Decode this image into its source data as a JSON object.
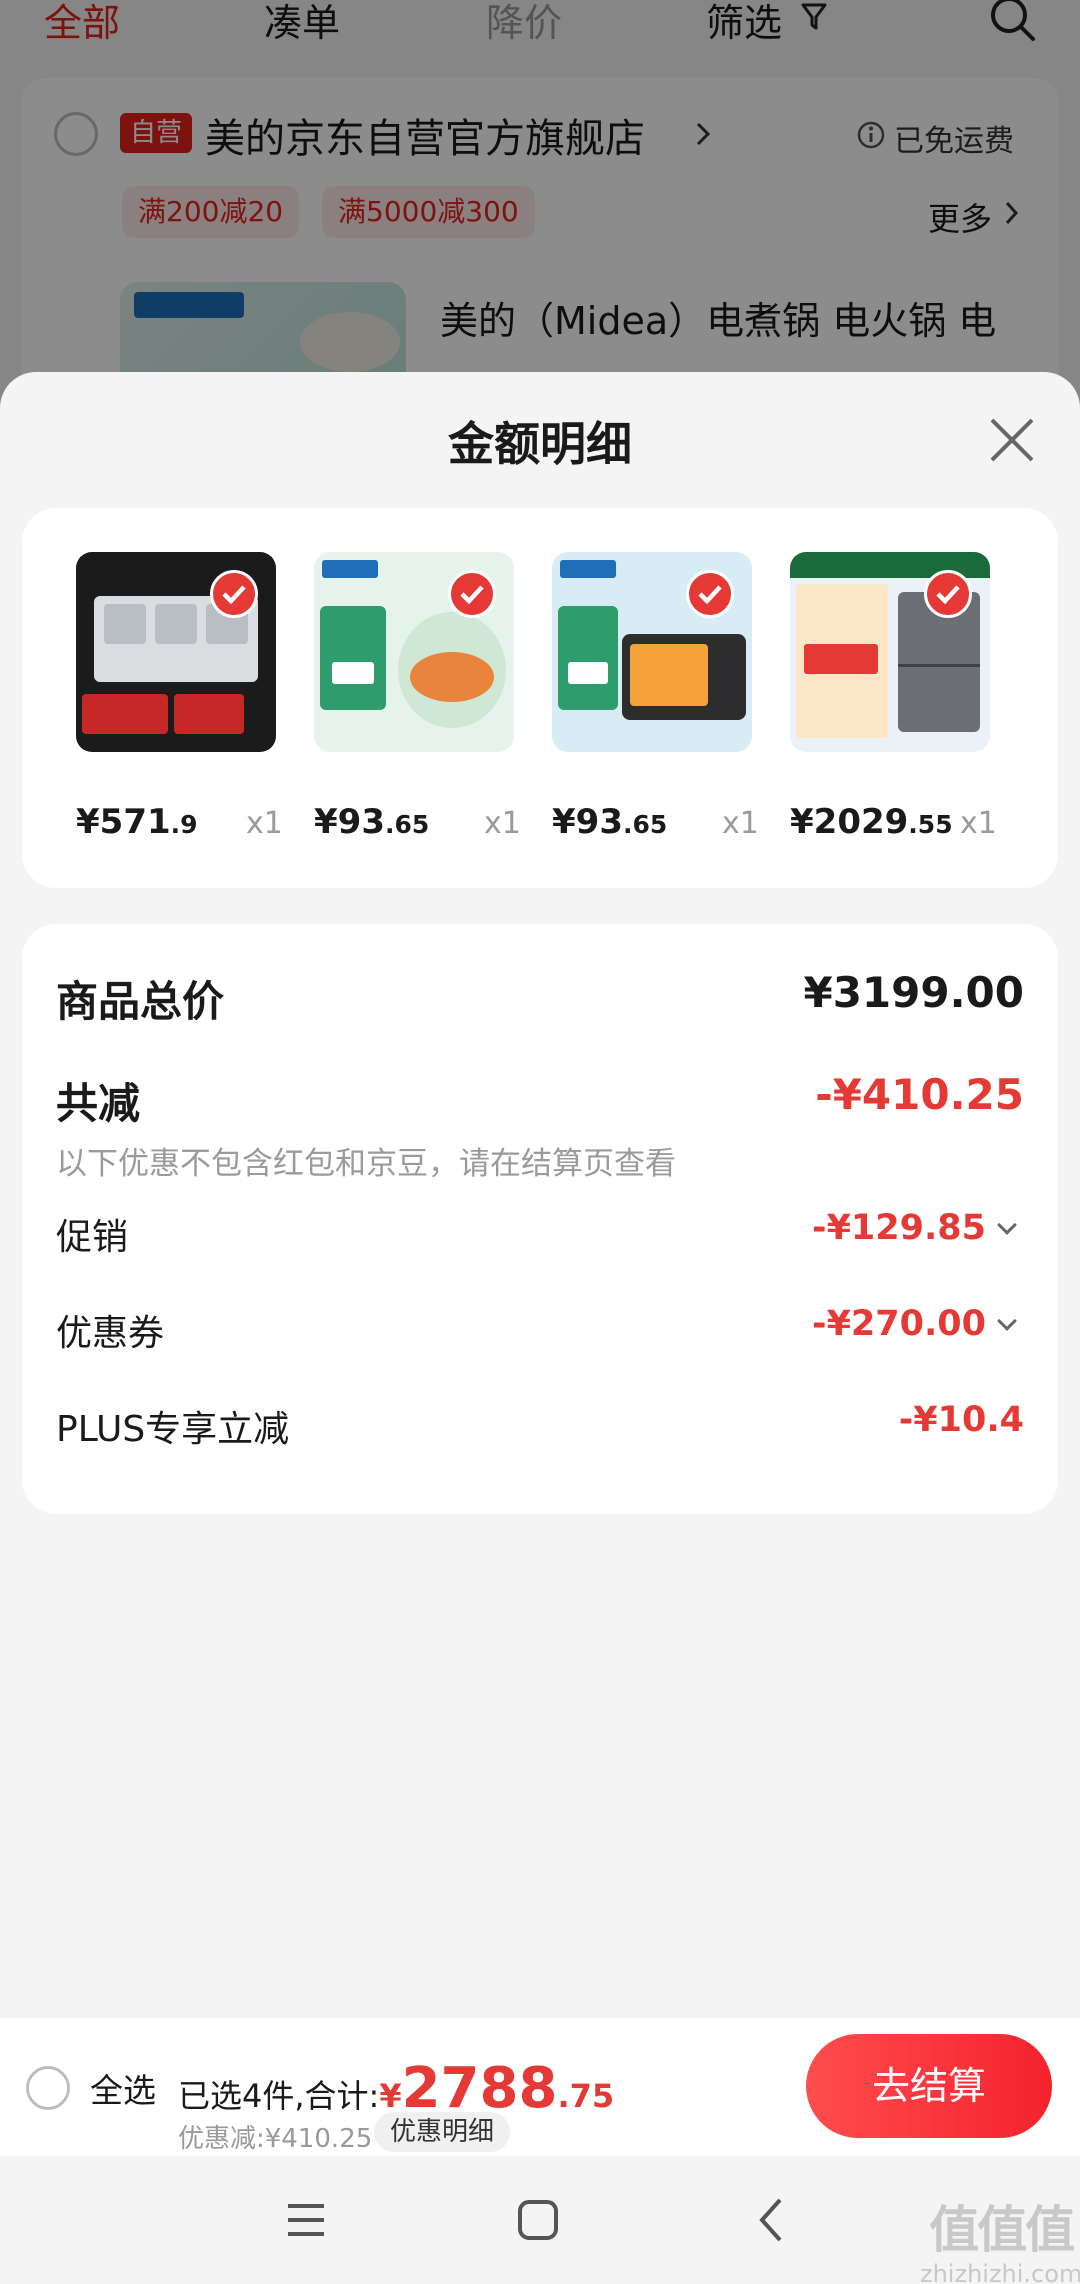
{
  "topnav": {
    "tabs": [
      {
        "label": "全部",
        "color": "#e2231a"
      },
      {
        "label": "凑单",
        "color": "#222222"
      },
      {
        "label": "降价",
        "color": "#9a9a9a"
      },
      {
        "label": "筛选",
        "color": "#222222"
      }
    ],
    "filter_icon": "filter-icon",
    "search_icon": "search-icon"
  },
  "store": {
    "badge": "自营",
    "name": "美的京东自营官方旗舰店",
    "shipping": "已免运费",
    "promos": [
      "满200减20",
      "满5000减300"
    ],
    "more": "更多",
    "first_item_title": "美的（Midea）电煮锅 电火锅 电"
  },
  "sheet": {
    "title": "金额明细",
    "products": [
      {
        "price_int": "¥571",
        "price_dec": ".9",
        "qty": "x1",
        "checked": true
      },
      {
        "price_int": "¥93",
        "price_dec": ".65",
        "qty": "x1",
        "checked": true
      },
      {
        "price_int": "¥93",
        "price_dec": ".65",
        "qty": "x1",
        "checked": true
      },
      {
        "price_int": "¥2029",
        "price_dec": ".55",
        "qty": "x1",
        "checked": true
      }
    ],
    "summary": {
      "total_label": "商品总价",
      "total_value": "¥3199.00",
      "reduce_label": "共减",
      "reduce_value": "-¥410.25",
      "note": "以下优惠不包含红包和京豆，请在结算页查看",
      "items": [
        {
          "label": "促销",
          "value": "-¥129.85"
        },
        {
          "label": "优惠券",
          "value": "-¥270.00"
        },
        {
          "label": "PLUS专享立减",
          "value": "-¥10.4"
        }
      ]
    }
  },
  "bottom": {
    "select_all": "全选",
    "selected_text": "已选4件,合计:",
    "total_currency": "¥",
    "total_int": "2788",
    "total_dec": ".75",
    "discount_text": "优惠减:¥410.25",
    "discount_button": "优惠明细",
    "checkout": "去结算"
  },
  "watermark": {
    "line1": "值值值",
    "line2": "zhizhizhi.com"
  },
  "colors": {
    "accent": "#e53935",
    "brand_red": "#e2231a"
  }
}
